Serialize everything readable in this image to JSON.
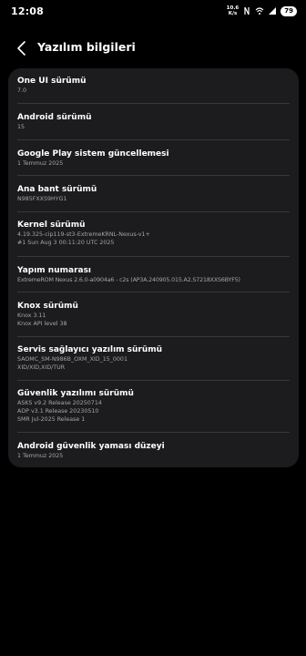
{
  "status_bar": {
    "time": "12:08",
    "net_speed_value": "10.6",
    "net_speed_unit": "K/s",
    "battery": "79"
  },
  "header": {
    "title": "Yazılım bilgileri"
  },
  "items": [
    {
      "title": "One UI sürümü",
      "lines": [
        "7.0"
      ]
    },
    {
      "title": "Android sürümü",
      "lines": [
        "15"
      ]
    },
    {
      "title": "Google Play sistem güncellemesi",
      "lines": [
        "1 Temmuz 2025"
      ]
    },
    {
      "title": "Ana bant sürümü",
      "lines": [
        "N985FXXS9HYG1"
      ]
    },
    {
      "title": "Kernel sürümü",
      "lines": [
        "4.19.325-cip119-st3-ExtremeKRNL-Nexus-v1+",
        "#1 Sun Aug 3 00:11:20 UTC 2025"
      ]
    },
    {
      "title": "Yapım numarası",
      "lines": [
        "ExtremeROM Nexus 2.6.0-a0904a6 - c2s (AP3A.240905.015.A2.S7218XXS6BYF5)"
      ]
    },
    {
      "title": "Knox sürümü",
      "lines": [
        "Knox 3.11",
        "Knox API level 38"
      ]
    },
    {
      "title": "Servis sağlayıcı yazılım sürümü",
      "lines": [
        "SAOMC_SM-N986B_OXM_XID_15_0001",
        "XID/XID,XID/TUR"
      ]
    },
    {
      "title": "Güvenlik yazılımı sürümü",
      "lines": [
        "ASKS v9.2  Release 20250714",
        "ADP v3.1 Release 20230510",
        "SMR Jul-2025 Release 1"
      ]
    },
    {
      "title": "Android güvenlik yaması düzeyi",
      "lines": [
        "1 Temmuz 2025"
      ]
    }
  ]
}
